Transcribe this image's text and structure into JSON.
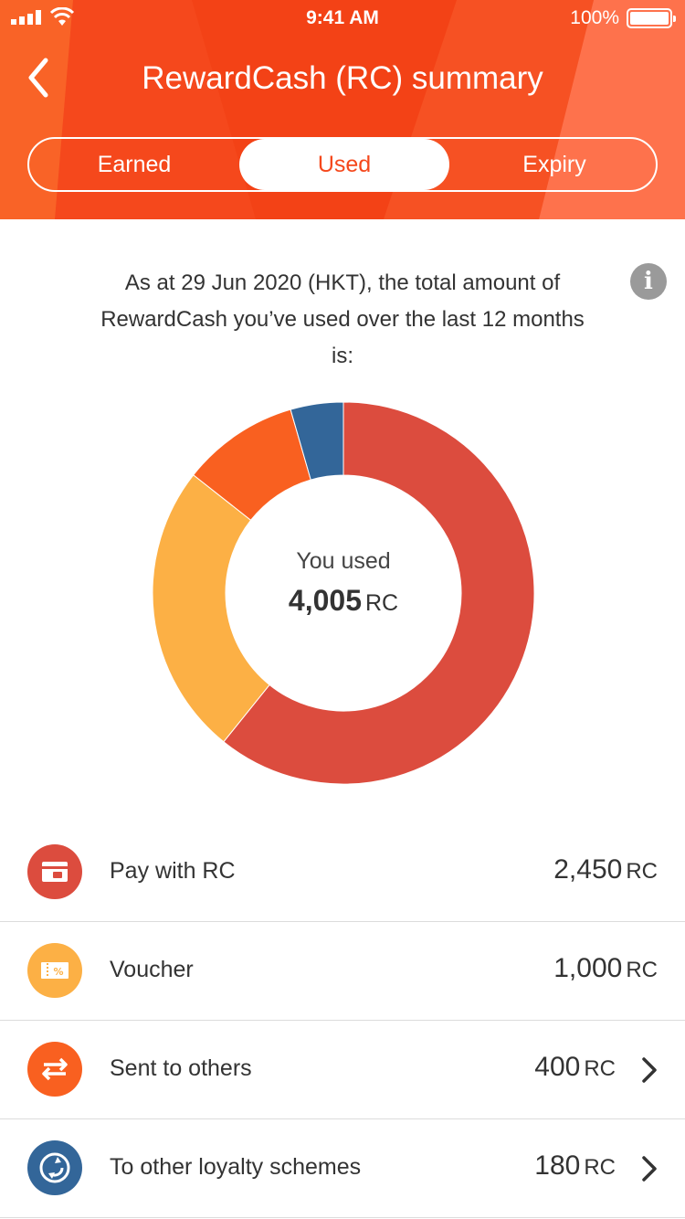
{
  "status_bar": {
    "time": "9:41 AM",
    "battery": "100%"
  },
  "header": {
    "title": "RewardCash (RC) summary",
    "back_icon": "chevron-left-icon"
  },
  "tabs": [
    {
      "label": "Earned",
      "selected": false
    },
    {
      "label": "Used",
      "selected": true
    },
    {
      "label": "Expiry",
      "selected": false
    }
  ],
  "summary": {
    "text_line1": "As at 29 Jun 2020 (HKT), the total amount of",
    "text_line2": "RewardCash you’ve used over the last 12 months",
    "text_line3": "is:",
    "info_icon": "info-icon"
  },
  "donut": {
    "label": "You used",
    "value": "4,005",
    "unit": "RC"
  },
  "chart_data": {
    "type": "pie",
    "categories": [
      "Pay with RC",
      "Voucher",
      "Sent to others",
      "To other loyalty schemes"
    ],
    "values": [
      2450,
      1000,
      400,
      180
    ],
    "colors": [
      "#dc4c3e",
      "#fcb045",
      "#f96020",
      "#336699"
    ]
  },
  "items": [
    {
      "label": "Pay with RC",
      "amount": "2,450",
      "unit": "RC",
      "icon": "wallet-icon",
      "color": "#dc4c3e",
      "has_arrow": false
    },
    {
      "label": "Voucher",
      "amount": "1,000",
      "unit": "RC",
      "icon": "voucher-icon",
      "color": "#fcb045",
      "has_arrow": false
    },
    {
      "label": "Sent to others",
      "amount": "400",
      "unit": "RC",
      "icon": "transfer-icon",
      "color": "#f96020",
      "has_arrow": true
    },
    {
      "label": "To other loyalty schemes",
      "amount": "180",
      "unit": "RC",
      "icon": "exchange-icon",
      "color": "#336699",
      "has_arrow": true
    }
  ]
}
